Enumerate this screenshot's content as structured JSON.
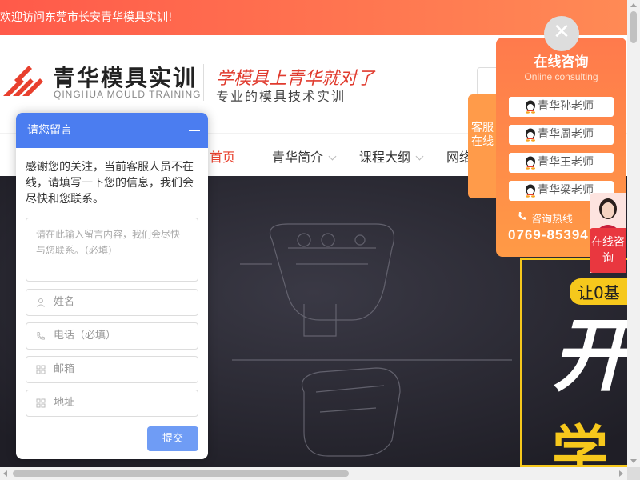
{
  "topbar": {
    "welcome": "欢迎访问东莞市长安青华模具实训!"
  },
  "header": {
    "brand_cn": "青华模具实训",
    "brand_en": "QINGHUA MOULD TRAINING",
    "slogan": "学模具上青华就对了",
    "slogan_sub": "专业的模具技术实训"
  },
  "nav": {
    "items": [
      {
        "label": "首页",
        "active": true
      },
      {
        "label": "青华简介"
      },
      {
        "label": "课程大纲"
      },
      {
        "label": "网络"
      }
    ]
  },
  "hero": {
    "badge": "让0基",
    "big1": "开",
    "big2": "学"
  },
  "message_panel": {
    "title": "请您留言",
    "intro": "感谢您的关注，当前客服人员不在线，请填写一下您的信息，我们会尽快和您联系。",
    "content_placeholder": "请在此输入留言内容，我们会尽快与您联系。（必填）",
    "fields": [
      {
        "placeholder": "姓名",
        "icon": "user-icon"
      },
      {
        "placeholder": "电话（必填）",
        "icon": "phone-icon"
      },
      {
        "placeholder": "邮箱",
        "icon": "grid-icon"
      },
      {
        "placeholder": "地址",
        "icon": "grid-icon"
      }
    ],
    "submit": "提交"
  },
  "service_tab": {
    "label": "客服在线"
  },
  "consult": {
    "title": "在线咨询",
    "subtitle": "Online consulting",
    "teachers": [
      "青华孙老师",
      "青华周老师",
      "青华王老师",
      "青华梁老师"
    ],
    "hotline_label": "咨询热线",
    "hotline_number": "0769-85394"
  },
  "chat_tab": {
    "label": "在线咨询"
  },
  "close": {
    "symbol": "✕"
  },
  "colors": {
    "accent": "#ff5a4a",
    "message_blue": "#4b7df0",
    "consult_orange": "#ff8a48",
    "hero_yellow": "#f6c81c"
  }
}
